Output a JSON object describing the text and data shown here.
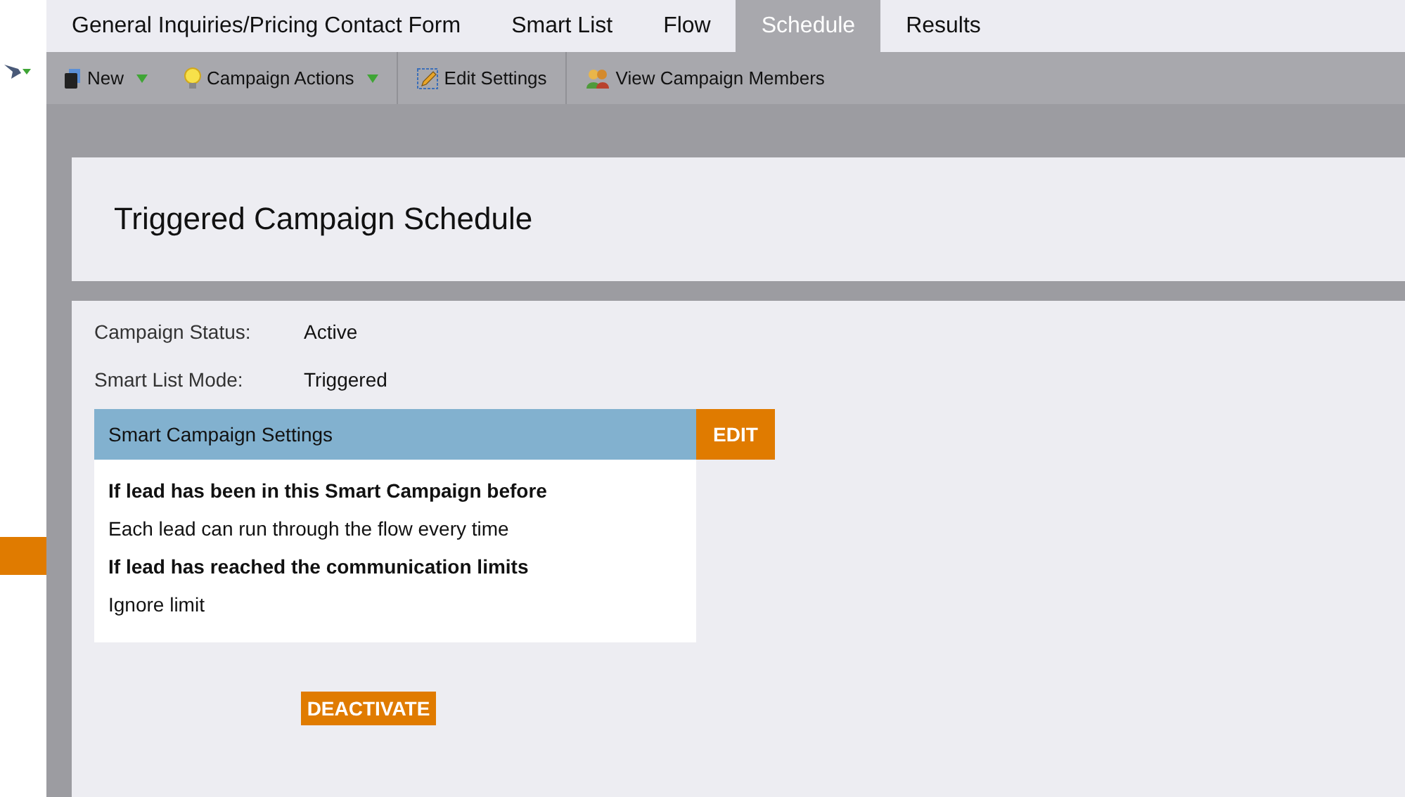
{
  "tabs": [
    {
      "label": "General Inquiries/Pricing Contact Form",
      "selected": false
    },
    {
      "label": "Smart List",
      "selected": false
    },
    {
      "label": "Flow",
      "selected": false
    },
    {
      "label": "Schedule",
      "selected": true
    },
    {
      "label": "Results",
      "selected": false
    }
  ],
  "toolbar": [
    {
      "label": "New",
      "menu": true,
      "separator_before": false
    },
    {
      "label": "Campaign Actions",
      "menu": true,
      "separator_before": false
    },
    {
      "label": "Edit Settings",
      "menu": false,
      "separator_before": true
    },
    {
      "label": "View Campaign Members",
      "menu": false,
      "separator_before": true
    }
  ],
  "page_title": "Triggered Campaign Schedule",
  "fields": [
    {
      "label": "Campaign Status:",
      "value": "Active"
    },
    {
      "label": "Smart List Mode:",
      "value": "Triggered"
    }
  ],
  "settings": {
    "title": "Smart Campaign Settings",
    "edit_button": "EDIT",
    "lines": [
      {
        "text": "If lead has been in this Smart Campaign before",
        "kind": "heading"
      },
      {
        "text": "Each lead can run through the flow every time",
        "kind": "value"
      },
      {
        "text": "If lead has reached the communication limits",
        "kind": "heading"
      },
      {
        "text": "Ignore limit",
        "kind": "value"
      }
    ]
  },
  "deactivate_button": "DEACTIVATE"
}
